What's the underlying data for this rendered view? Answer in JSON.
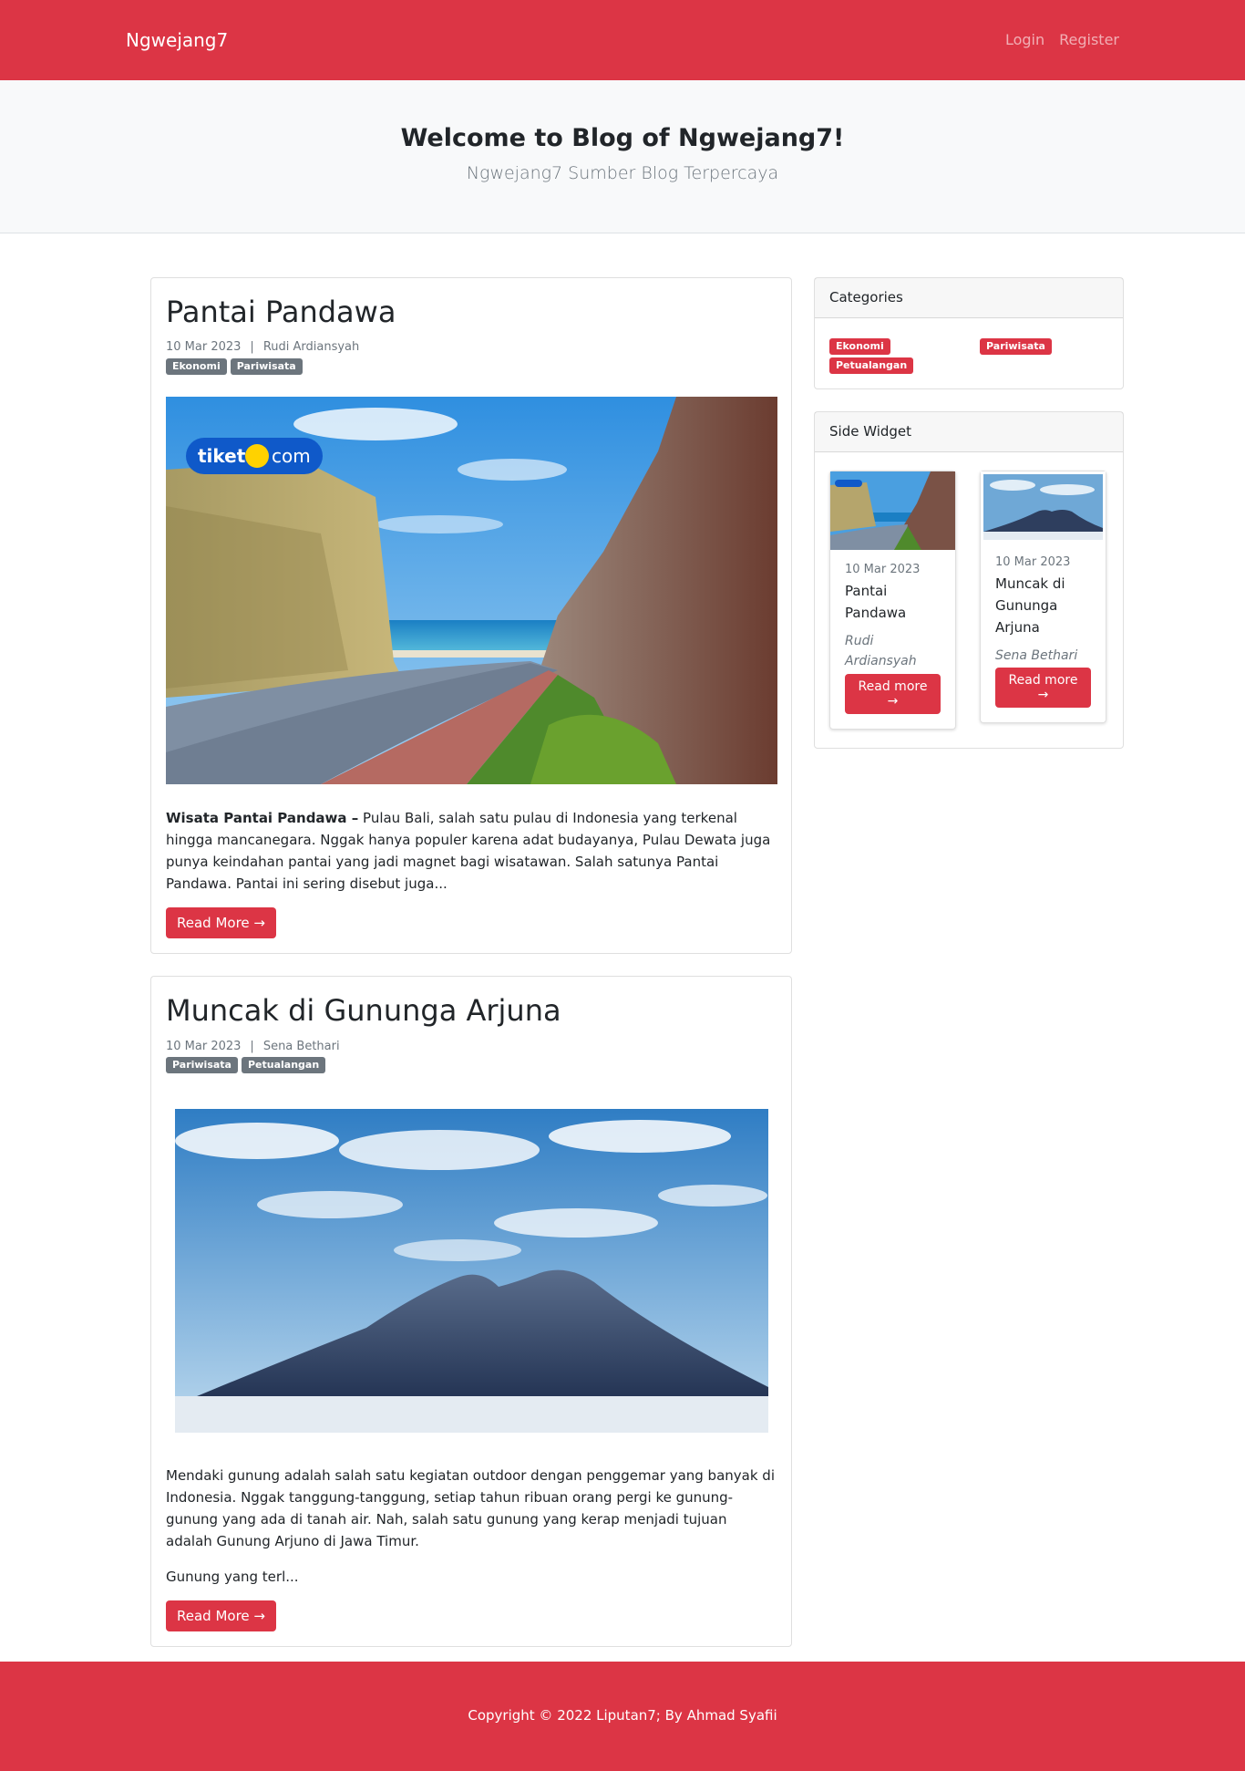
{
  "navbar": {
    "brand": "Ngwejang7",
    "links": [
      "Login",
      "Register"
    ]
  },
  "hero": {
    "title": "Welcome to Blog of Ngwejang7!",
    "subtitle": "Ngwejang7 Sumber Blog Terpercaya"
  },
  "posts": [
    {
      "title": "Pantai Pandawa",
      "date": "10 Mar 2023",
      "separator": "|",
      "author": "Rudi Ardiansyah",
      "tags": [
        "Ekonomi",
        "Pariwisata"
      ],
      "image_logo": "tiket",
      "image_logo_suffix": "com",
      "excerpt_bold": "Wisata Pantai Pandawa –",
      "excerpt": " Pulau Bali, salah satu pulau di Indonesia yang terkenal hingga mancanegara. Nggak hanya populer karena adat budayanya, Pulau Dewata juga punya keindahan pantai yang jadi magnet bagi wisatawan. Salah satunya Pantai Pandawa. Pantai ini sering disebut juga...",
      "read_more": "Read More →"
    },
    {
      "title": "Muncak di Gununga Arjuna",
      "date": "10 Mar 2023",
      "separator": "|",
      "author": "Sena Bethari",
      "tags": [
        "Pariwisata",
        "Petualangan"
      ],
      "excerpt_p1": "Mendaki gunung adalah salah satu kegiatan outdoor dengan penggemar yang banyak di Indonesia. Nggak tanggung-tanggung, setiap tahun ribuan orang pergi ke gunung-gunung yang ada di tanah air. Nah, salah satu gunung yang kerap menjadi tujuan adalah Gunung Arjuno di Jawa Timur.",
      "excerpt_p2": "Gunung yang terl...",
      "read_more": "Read More →"
    }
  ],
  "sidebar": {
    "categories_title": "Categories",
    "categories": [
      "Ekonomi",
      "Pariwisata",
      "Petualangan"
    ],
    "widget_title": "Side Widget",
    "widgets": [
      {
        "date": "10 Mar 2023",
        "title": "Pantai Pandawa",
        "author": "Rudi Ardiansyah",
        "button": "Read more →"
      },
      {
        "date": "10 Mar 2023",
        "title": "Muncak di Gununga Arjuna",
        "author": "Sena Bethari",
        "button": "Read more →"
      }
    ]
  },
  "footer": {
    "copyright": "Copyright © 2022 Liputan7; By Ahmad Syafii"
  },
  "colors": {
    "primary": "#dc3545",
    "light_bg": "#f8f9fa",
    "muted": "#6c757d"
  }
}
